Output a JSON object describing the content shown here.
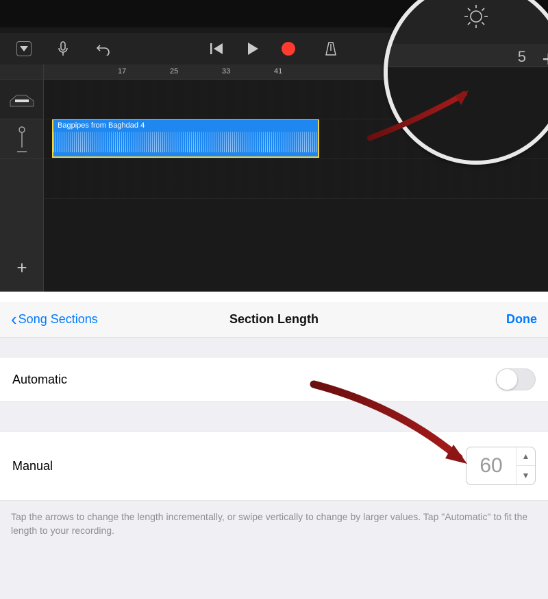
{
  "toolbar": {
    "dropdown_name": "view-selector",
    "mic_name": "microphone-icon",
    "undo_name": "undo-icon",
    "prev_name": "go-to-beginning-icon",
    "play_name": "play-icon",
    "record_name": "record-icon",
    "metronome_name": "metronome-icon"
  },
  "ruler": {
    "marks": [
      "17",
      "25",
      "33",
      "41"
    ]
  },
  "tracks": {
    "piano_name": "piano-track",
    "mic_name": "audio-track",
    "region_label": "Bagpipes from Baghdad 4",
    "add_label": "+"
  },
  "mag": {
    "gear_name": "settings-gear-icon",
    "ruler_mark": "5",
    "plus_label": "+"
  },
  "panel": {
    "back_label": "Song Sections",
    "title": "Section Length",
    "done_label": "Done",
    "automatic_label": "Automatic",
    "manual_label": "Manual",
    "manual_value": "60",
    "hint": "Tap the arrows to change the length incrementally, or swipe vertically to change by larger values. Tap \"Automatic\" to fit the length to your recording."
  }
}
